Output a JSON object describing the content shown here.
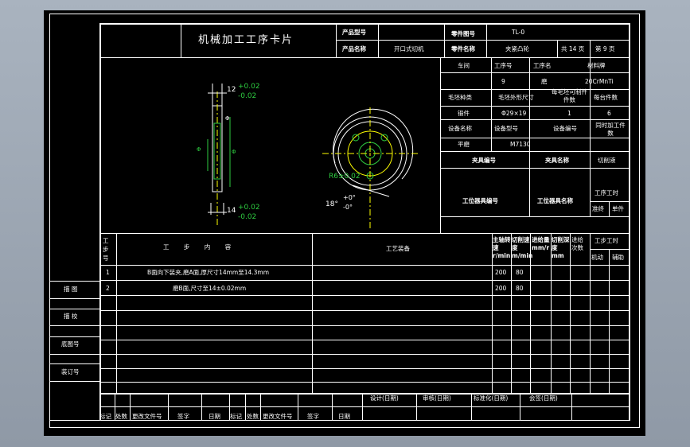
{
  "card": {
    "title": "机械加工工序卡片"
  },
  "header": {
    "product_code_label": "产品型号",
    "product_code": "",
    "part_code_label": "零件图号",
    "part_code": "TL-0",
    "product_name_label": "产品名称",
    "product_name": "开口式切机",
    "part_name_label": "零件名称",
    "part_name": "夹紧凸轮",
    "total_pages": "共 14 页",
    "page_no": "第 9 页"
  },
  "process": {
    "workshop_label": "车间",
    "op_no_label": "工序号",
    "op_name_label": "工序名",
    "material_label": "材料牌",
    "op_no": "9",
    "op_name": "磨",
    "material": "20CrMnTi",
    "blank_type_label": "毛坯种类",
    "blank_size_label": "毛坯外形尺寸",
    "blank_parts_label": "每毛坯可制件件数",
    "parts_per_unit_label": "每台件数",
    "blank_type": "锻件",
    "blank_size": "Φ29×19",
    "blank_parts": "1",
    "parts_per_unit": "6",
    "equip_name_label": "设备名称",
    "equip_model_label": "设备型号",
    "equip_no_label": "设备编号",
    "simul_parts_label": "同时加工件数",
    "equip_name": "平磨",
    "equip_model": "M7130",
    "fixture_no_label": "夹具编号",
    "fixture_name_label": "夹具名称",
    "coolant_label": "切削液",
    "station_tool_no_label": "工位器具编号",
    "station_tool_name_label": "工位器具名称",
    "op_hours_label": "工序工时",
    "prep_label": "准终",
    "unit_label": "单件"
  },
  "drawing": {
    "dim_top": "12",
    "tol_top_plus": "+0.02",
    "tol_top_minus": "-0.02",
    "dim_bottom": "14",
    "tol_bottom_plus": "+0.02",
    "tol_bottom_minus": "-0.02",
    "angle": "18°",
    "angle_plus": "+0°",
    "angle_minus": "-0°",
    "radius": "R6±0.02"
  },
  "steps_header": {
    "step_no": "工步号",
    "content": "工 步 内 容",
    "equipment": "工艺装备",
    "spindle": "主轴转速 r/min",
    "speed": "切削速度 m/min",
    "feed": "进给量 mm/r",
    "depth": "切削深度 mm",
    "passes": "进给次数",
    "hours": "工步工时",
    "motor": "机动",
    "aux": "辅助"
  },
  "steps": [
    {
      "no": "1",
      "content": "B面向下装夹,磨A面,厚尺寸14mm至14.3mm",
      "spindle": "200",
      "speed": "80"
    },
    {
      "no": "2",
      "content": "磨B面,尺寸至14±0.02mm",
      "spindle": "200",
      "speed": "80"
    }
  ],
  "side": {
    "drawn": "描 图",
    "checked": "描 校",
    "base_no": "底图号",
    "binding_no": "装订号"
  },
  "footer": {
    "design": "设计(日期)",
    "review": "审核(日期)",
    "standard": "标准化(日期)",
    "sign": "会签(日期)",
    "mark": "标记",
    "count": "处数",
    "doc_no": "更改文件号",
    "signature": "签字",
    "date": "日期"
  }
}
